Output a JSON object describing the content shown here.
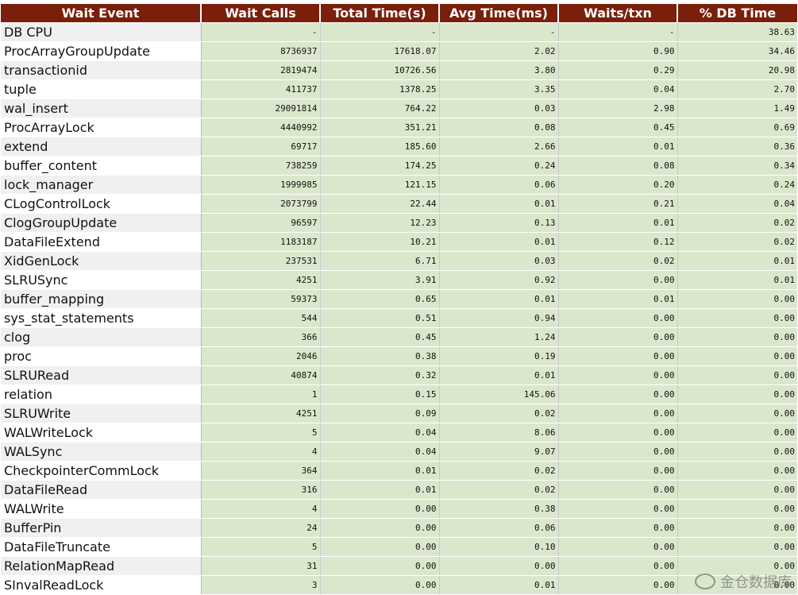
{
  "table": {
    "headers": [
      "Wait Event",
      "Wait Calls",
      "Total Time(s)",
      "Avg Time(ms)",
      "Waits/txn",
      "% DB Time"
    ],
    "rows": [
      [
        "DB CPU",
        "-",
        "-",
        "-",
        "-",
        "38.63"
      ],
      [
        "ProcArrayGroupUpdate",
        "8736937",
        "17618.07",
        "2.02",
        "0.90",
        "34.46"
      ],
      [
        "transactionid",
        "2819474",
        "10726.56",
        "3.80",
        "0.29",
        "20.98"
      ],
      [
        "tuple",
        "411737",
        "1378.25",
        "3.35",
        "0.04",
        "2.70"
      ],
      [
        "wal_insert",
        "29091814",
        "764.22",
        "0.03",
        "2.98",
        "1.49"
      ],
      [
        "ProcArrayLock",
        "4440992",
        "351.21",
        "0.08",
        "0.45",
        "0.69"
      ],
      [
        "extend",
        "69717",
        "185.60",
        "2.66",
        "0.01",
        "0.36"
      ],
      [
        "buffer_content",
        "738259",
        "174.25",
        "0.24",
        "0.08",
        "0.34"
      ],
      [
        "lock_manager",
        "1999985",
        "121.15",
        "0.06",
        "0.20",
        "0.24"
      ],
      [
        "CLogControlLock",
        "2073799",
        "22.44",
        "0.01",
        "0.21",
        "0.04"
      ],
      [
        "ClogGroupUpdate",
        "96597",
        "12.23",
        "0.13",
        "0.01",
        "0.02"
      ],
      [
        "DataFileExtend",
        "1183187",
        "10.21",
        "0.01",
        "0.12",
        "0.02"
      ],
      [
        "XidGenLock",
        "237531",
        "6.71",
        "0.03",
        "0.02",
        "0.01"
      ],
      [
        "SLRUSync",
        "4251",
        "3.91",
        "0.92",
        "0.00",
        "0.01"
      ],
      [
        "buffer_mapping",
        "59373",
        "0.65",
        "0.01",
        "0.01",
        "0.00"
      ],
      [
        "sys_stat_statements",
        "544",
        "0.51",
        "0.94",
        "0.00",
        "0.00"
      ],
      [
        "clog",
        "366",
        "0.45",
        "1.24",
        "0.00",
        "0.00"
      ],
      [
        "proc",
        "2046",
        "0.38",
        "0.19",
        "0.00",
        "0.00"
      ],
      [
        "SLRURead",
        "40874",
        "0.32",
        "0.01",
        "0.00",
        "0.00"
      ],
      [
        "relation",
        "1",
        "0.15",
        "145.06",
        "0.00",
        "0.00"
      ],
      [
        "SLRUWrite",
        "4251",
        "0.09",
        "0.02",
        "0.00",
        "0.00"
      ],
      [
        "WALWriteLock",
        "5",
        "0.04",
        "8.06",
        "0.00",
        "0.00"
      ],
      [
        "WALSync",
        "4",
        "0.04",
        "9.07",
        "0.00",
        "0.00"
      ],
      [
        "CheckpointerCommLock",
        "364",
        "0.01",
        "0.02",
        "0.00",
        "0.00"
      ],
      [
        "DataFileRead",
        "316",
        "0.01",
        "0.02",
        "0.00",
        "0.00"
      ],
      [
        "WALWrite",
        "4",
        "0.00",
        "0.38",
        "0.00",
        "0.00"
      ],
      [
        "BufferPin",
        "24",
        "0.00",
        "0.06",
        "0.00",
        "0.00"
      ],
      [
        "DataFileTruncate",
        "5",
        "0.00",
        "0.10",
        "0.00",
        "0.00"
      ],
      [
        "RelationMapRead",
        "31",
        "0.00",
        "0.00",
        "0.00",
        "0.00"
      ],
      [
        "SInvalReadLock",
        "3",
        "0.00",
        "0.01",
        "0.00",
        "0.00"
      ]
    ]
  },
  "watermark": {
    "text": "金仓数据库",
    "icon": "weibo-icon"
  },
  "colors": {
    "header_bg": "#7a1f0a",
    "numeric_bg": "#dbe7cc",
    "zebra_bg": "#f0f0f0"
  }
}
